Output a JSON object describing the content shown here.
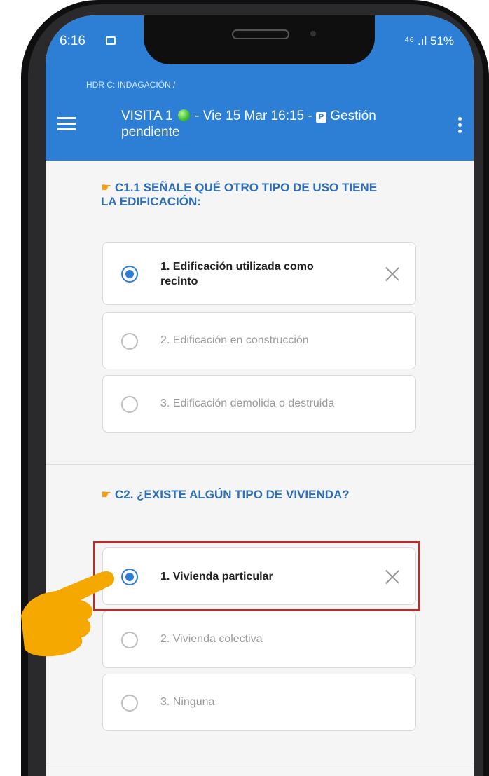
{
  "status_bar": {
    "time": "6:16",
    "right": "⁴⁶ .ıl 51%"
  },
  "header": {
    "breadcrumb": "HDR C: INDAGACIÓN /",
    "title_line1_part1": "VISITA 1",
    "title_line1_part2": "- Vie 15 Mar 16:15 -",
    "title_badge": "P",
    "title_line1_part3": "Gestión",
    "title_line2": "pendiente"
  },
  "questions": [
    {
      "hand": "☛",
      "line1": "C1.1 SEÑALE QUÉ OTRO TIPO DE USO TIENE",
      "line2": "LA EDIFICACIÓN:",
      "options": [
        {
          "line1": "1. Edificación utilizada como",
          "line2": "recinto",
          "selected": true
        },
        {
          "label": "2. Edificación en construcción",
          "selected": false
        },
        {
          "label": "3. Edificación demolida o destruida",
          "selected": false
        }
      ]
    },
    {
      "hand": "☛",
      "line1": "C2. ¿EXISTE ALGÚN TIPO DE VIVIENDA?",
      "options": [
        {
          "label": "1. Vivienda particular",
          "selected": true
        },
        {
          "label": "2. Vivienda colectiva",
          "selected": false
        },
        {
          "label": "3. Ninguna",
          "selected": false
        }
      ]
    }
  ],
  "colors": {
    "appbar": "#2d7fd5",
    "question": "#2c6fb8",
    "highlight": "#b03030",
    "pointer_hand": "#f5a800"
  },
  "icons": [
    "menu-icon",
    "more-vert-icon",
    "radio-checked-icon",
    "radio-unchecked-icon",
    "close-icon",
    "pointing-hand-icon",
    "green-status-icon"
  ]
}
